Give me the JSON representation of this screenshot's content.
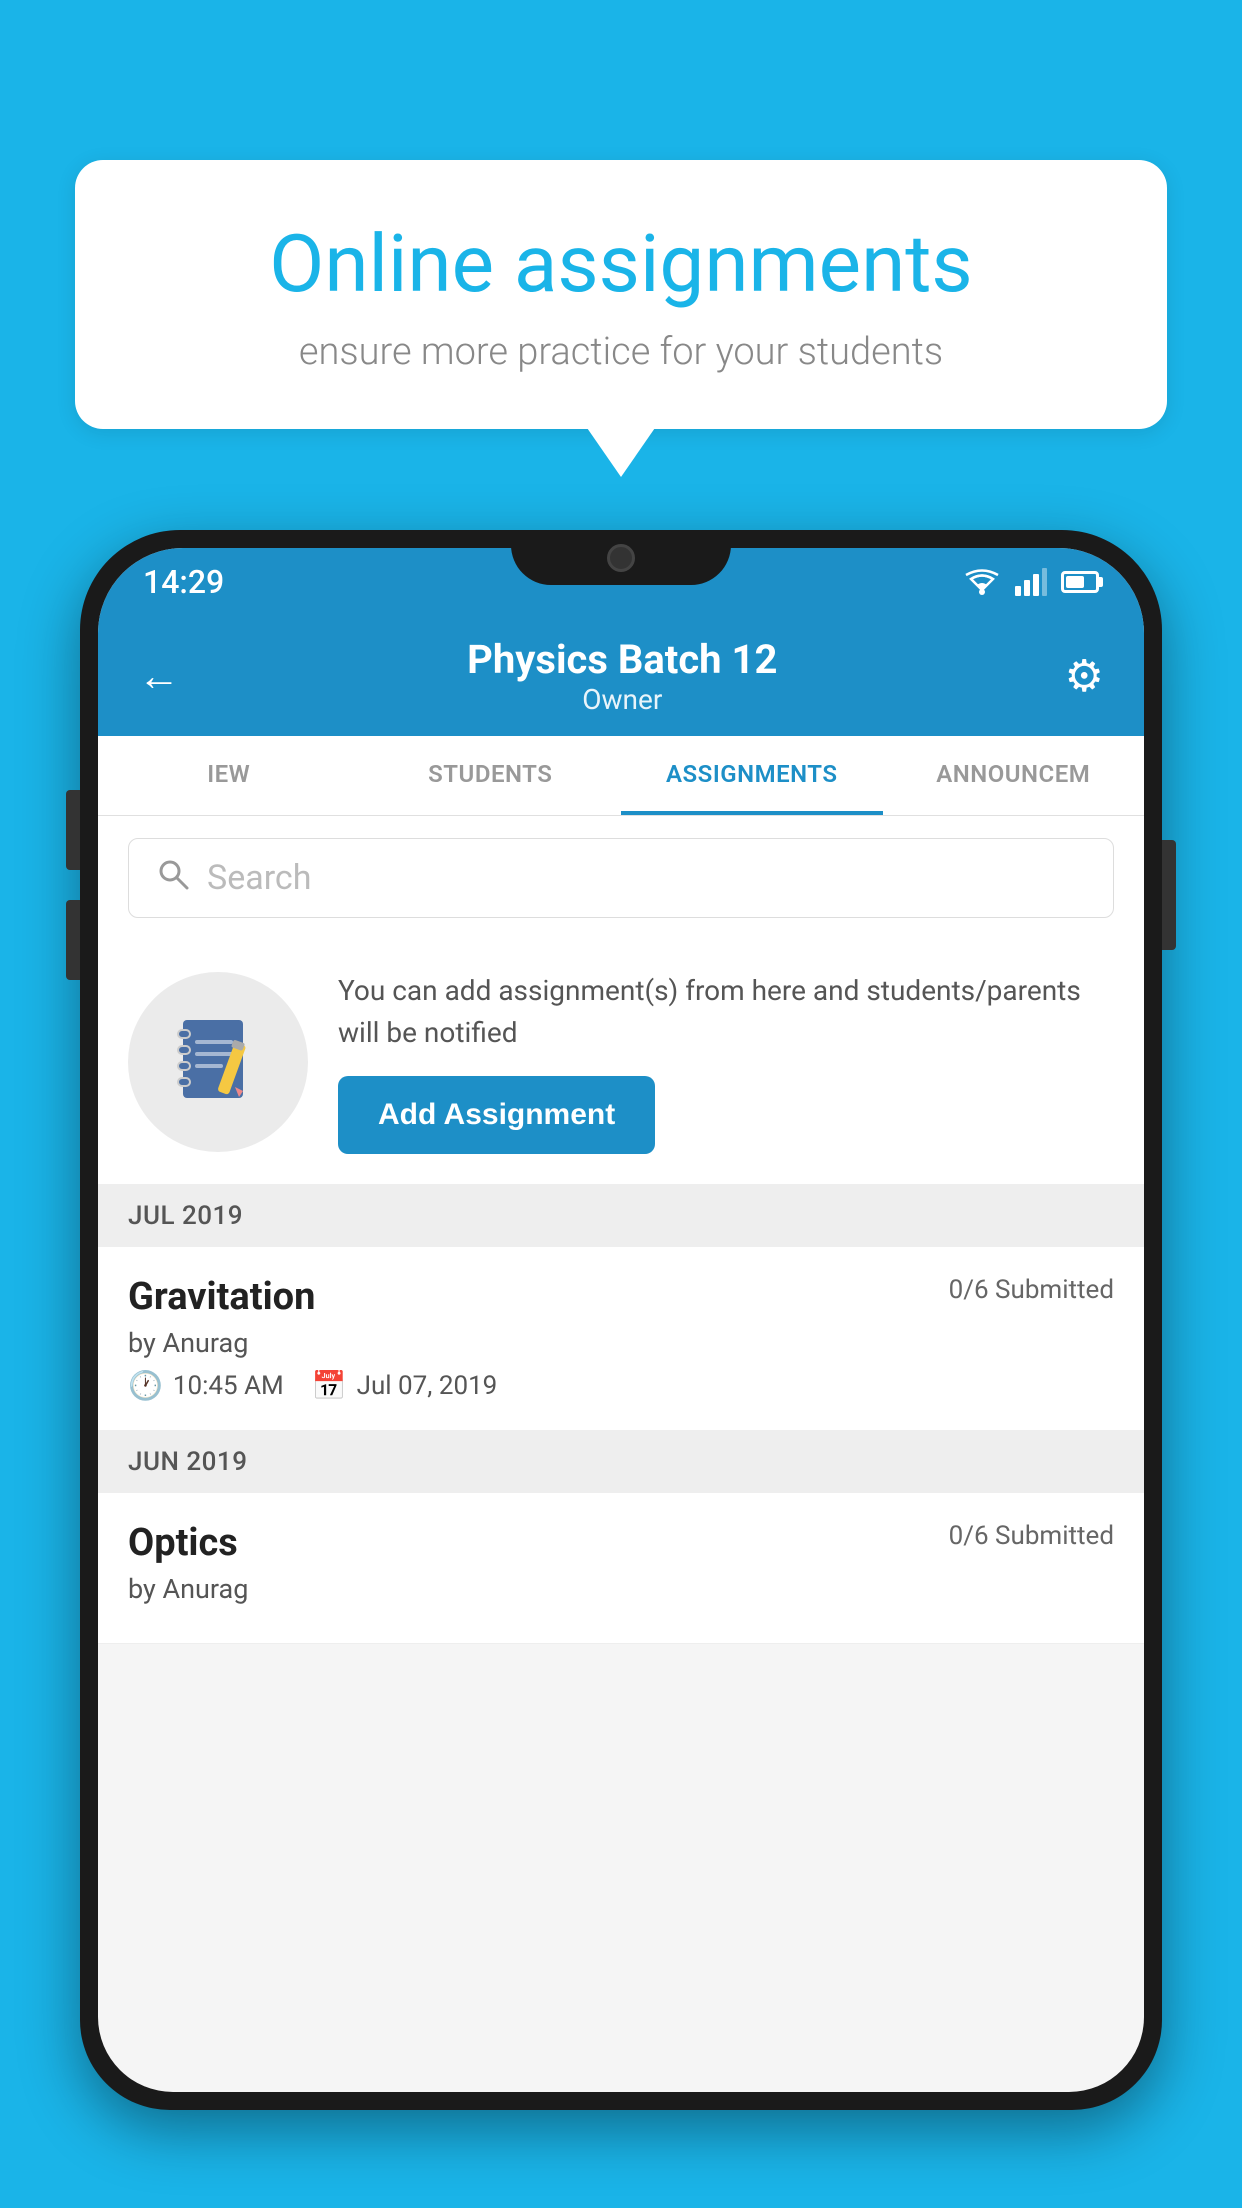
{
  "background_color": "#1ab4e8",
  "speech_bubble": {
    "title": "Online assignments",
    "subtitle": "ensure more practice for your students"
  },
  "phone": {
    "status_bar": {
      "time": "14:29"
    },
    "header": {
      "title": "Physics Batch 12",
      "subtitle": "Owner",
      "back_label": "←",
      "settings_label": "⚙"
    },
    "tabs": [
      {
        "label": "IEW",
        "active": false
      },
      {
        "label": "STUDENTS",
        "active": false
      },
      {
        "label": "ASSIGNMENTS",
        "active": true
      },
      {
        "label": "ANNOUNCEM",
        "active": false
      }
    ],
    "search": {
      "placeholder": "Search"
    },
    "add_assignment": {
      "description": "You can add assignment(s) from here and students/parents will be notified",
      "button_label": "Add Assignment"
    },
    "assignment_groups": [
      {
        "month": "JUL 2019",
        "assignments": [
          {
            "name": "Gravitation",
            "submitted": "0/6 Submitted",
            "by": "by Anurag",
            "time": "10:45 AM",
            "date": "Jul 07, 2019"
          }
        ]
      },
      {
        "month": "JUN 2019",
        "assignments": [
          {
            "name": "Optics",
            "submitted": "0/6 Submitted",
            "by": "by Anurag",
            "time": "",
            "date": ""
          }
        ]
      }
    ]
  }
}
